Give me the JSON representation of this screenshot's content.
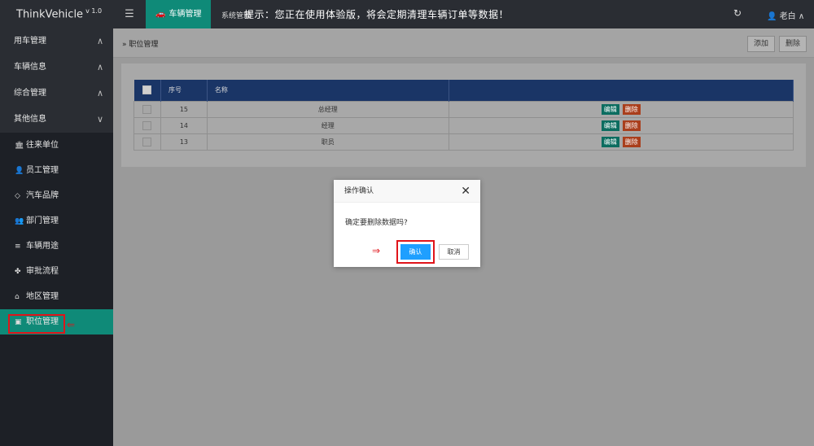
{
  "app": {
    "name": "ThinkVehicle",
    "version": "v 1.0"
  },
  "topbar": {
    "menu_icon": "menu-icon",
    "module_tab": "车辆管理",
    "car_icon": "car-icon",
    "system_tab": "系统管理",
    "notice": "提示：您正在使用体验版，将会定期清理车辆订单等数据！",
    "refresh_icon": "refresh-icon",
    "user_name": "老白",
    "user_icon": "user-icon"
  },
  "sidebar": {
    "groups": [
      {
        "label": "用车管理",
        "arrow": "∧"
      },
      {
        "label": "车辆信息",
        "arrow": "∧"
      },
      {
        "label": "综合管理",
        "arrow": "∧"
      },
      {
        "label": "其他信息",
        "arrow": "∨"
      }
    ],
    "items": [
      {
        "label": "往来单位",
        "icon": "bank-icon"
      },
      {
        "label": "员工管理",
        "icon": "person-icon"
      },
      {
        "label": "汽车品牌",
        "icon": "diamond-icon"
      },
      {
        "label": "部门管理",
        "icon": "users-icon"
      },
      {
        "label": "车辆用途",
        "icon": "list-icon"
      },
      {
        "label": "审批流程",
        "icon": "android-icon"
      },
      {
        "label": "地区管理",
        "icon": "home-icon"
      },
      {
        "label": "职位管理",
        "icon": "camera-icon"
      }
    ],
    "active_item": "职位管理"
  },
  "content": {
    "breadcrumb": "职位管理",
    "add_button": "添加",
    "delete_button": "删除",
    "table": {
      "headers": [
        "序号",
        "名称",
        ""
      ],
      "rows": [
        {
          "id": "15",
          "name": "总经理",
          "edit": "编辑",
          "del": "删除"
        },
        {
          "id": "14",
          "name": "经理",
          "edit": "编辑",
          "del": "删除"
        },
        {
          "id": "13",
          "name": "职员",
          "edit": "编辑",
          "del": "删除"
        }
      ]
    }
  },
  "modal": {
    "title": "操作确认",
    "message": "确定要删除数据吗?",
    "ok_label": "确认",
    "cancel_label": "取消",
    "close_icon": "close-icon"
  },
  "colors": {
    "accent": "#009688",
    "table_header": "#1a3566",
    "ok_button": "#1e9fff",
    "annotation": "#e0141a"
  }
}
